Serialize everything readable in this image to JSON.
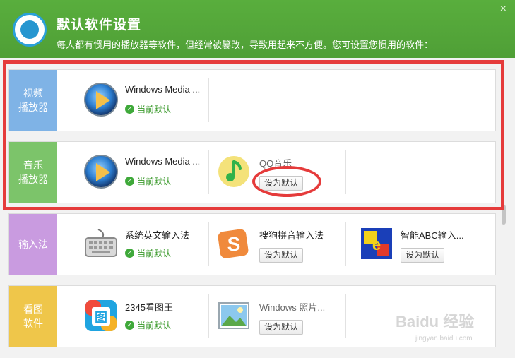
{
  "header": {
    "title": "默认软件设置",
    "subtitle": "每人都有惯用的播放器等软件，但经常被篡改，导致用起来不方便。您可设置您惯用的软件：",
    "close": "×"
  },
  "categories": [
    {
      "label": "视频\n播放器",
      "color": "#7fb3e6",
      "apps": [
        {
          "name": "Windows Media ...",
          "icon": "windows-media-player-icon",
          "status": "当前默认"
        }
      ]
    },
    {
      "label": "音乐\n播放器",
      "color": "#7cc46a",
      "apps": [
        {
          "name": "Windows Media ...",
          "icon": "windows-media-player-icon",
          "status": "当前默认"
        },
        {
          "name": "QQ音乐",
          "icon": "qq-music-icon",
          "action": "设为默认"
        }
      ]
    },
    {
      "label": "输入法",
      "color": "#c99be0",
      "apps": [
        {
          "name": "系统英文输入法",
          "icon": "keyboard-icon",
          "status": "当前默认"
        },
        {
          "name": "搜狗拼音输入法",
          "icon": "sogou-pinyin-icon",
          "action": "设为默认"
        },
        {
          "name": "智能ABC输入...",
          "icon": "abc-input-icon",
          "action": "设为默认"
        }
      ]
    },
    {
      "label": "看图\n软件",
      "color": "#efc64a",
      "apps": [
        {
          "name": "2345看图王",
          "icon": "2345-image-viewer-icon",
          "status": "当前默认"
        },
        {
          "name": "Windows 照片...",
          "icon": "windows-photo-viewer-icon",
          "action": "设为默认"
        }
      ]
    }
  ],
  "watermark": {
    "main": "Baidu 经验",
    "sub": "jingyan.baidu.com"
  }
}
